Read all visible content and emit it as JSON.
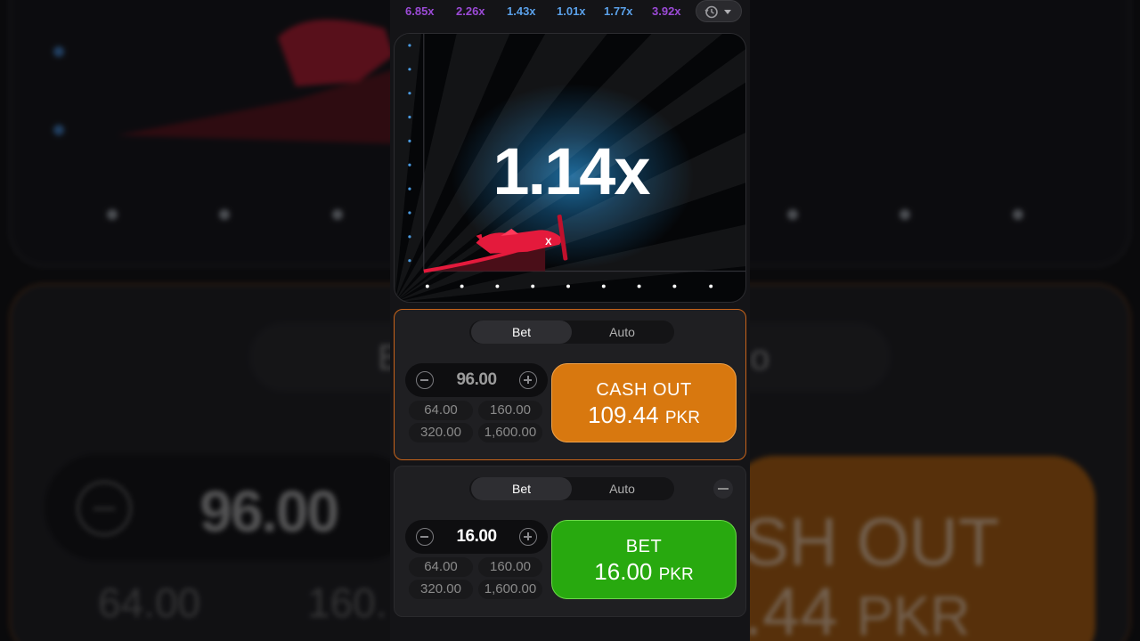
{
  "history": [
    {
      "value": "6.85x",
      "color": "#9b4ad6"
    },
    {
      "value": "2.26x",
      "color": "#9b4ad6"
    },
    {
      "value": "1.43x",
      "color": "#5aa0e8"
    },
    {
      "value": "1.01x",
      "color": "#5aa0e8"
    },
    {
      "value": "1.77x",
      "color": "#5aa0e8"
    },
    {
      "value": "3.92x",
      "color": "#9b4ad6"
    }
  ],
  "game": {
    "multiplier": "1.14x",
    "plane_color": "#e41a3c"
  },
  "panel1": {
    "tabs": [
      "Bet",
      "Auto"
    ],
    "amount": "96.00",
    "quick": [
      "64.00",
      "160.00",
      "320.00",
      "1,600.00"
    ],
    "action_label": "CASH OUT",
    "action_value": "109.44",
    "action_currency": "PKR"
  },
  "panel2": {
    "tabs": [
      "Bet",
      "Auto"
    ],
    "amount": "16.00",
    "quick": [
      "64.00",
      "160.00",
      "320.00",
      "1,600.00"
    ],
    "action_label": "BET",
    "action_value": "16.00",
    "action_currency": "PKR"
  },
  "background": {
    "tab_left": "B",
    "tab_right": "o",
    "amount": "96.00",
    "quick_1": "64.00",
    "quick_2": "160.",
    "cash_label": "SH OUT",
    "cash_value": ".44",
    "cash_currency": "PKR"
  }
}
